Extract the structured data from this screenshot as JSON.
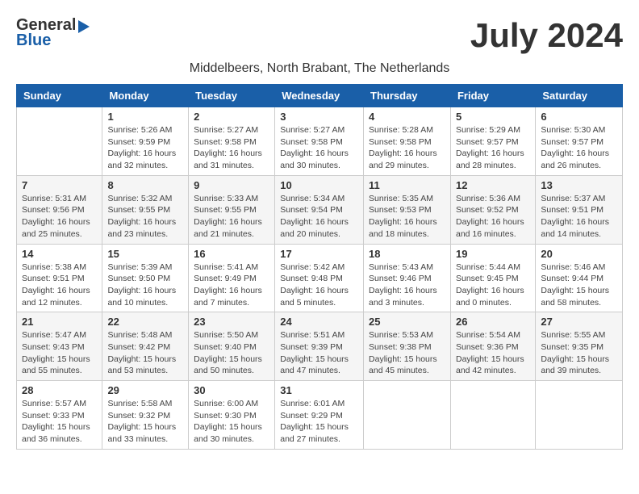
{
  "header": {
    "logo_general": "General",
    "logo_blue": "Blue",
    "month_title": "July 2024",
    "location": "Middelbeers, North Brabant, The Netherlands"
  },
  "weekdays": [
    "Sunday",
    "Monday",
    "Tuesday",
    "Wednesday",
    "Thursday",
    "Friday",
    "Saturday"
  ],
  "weeks": [
    [
      {
        "day": "",
        "info": ""
      },
      {
        "day": "1",
        "info": "Sunrise: 5:26 AM\nSunset: 9:59 PM\nDaylight: 16 hours\nand 32 minutes."
      },
      {
        "day": "2",
        "info": "Sunrise: 5:27 AM\nSunset: 9:58 PM\nDaylight: 16 hours\nand 31 minutes."
      },
      {
        "day": "3",
        "info": "Sunrise: 5:27 AM\nSunset: 9:58 PM\nDaylight: 16 hours\nand 30 minutes."
      },
      {
        "day": "4",
        "info": "Sunrise: 5:28 AM\nSunset: 9:58 PM\nDaylight: 16 hours\nand 29 minutes."
      },
      {
        "day": "5",
        "info": "Sunrise: 5:29 AM\nSunset: 9:57 PM\nDaylight: 16 hours\nand 28 minutes."
      },
      {
        "day": "6",
        "info": "Sunrise: 5:30 AM\nSunset: 9:57 PM\nDaylight: 16 hours\nand 26 minutes."
      }
    ],
    [
      {
        "day": "7",
        "info": "Sunrise: 5:31 AM\nSunset: 9:56 PM\nDaylight: 16 hours\nand 25 minutes."
      },
      {
        "day": "8",
        "info": "Sunrise: 5:32 AM\nSunset: 9:55 PM\nDaylight: 16 hours\nand 23 minutes."
      },
      {
        "day": "9",
        "info": "Sunrise: 5:33 AM\nSunset: 9:55 PM\nDaylight: 16 hours\nand 21 minutes."
      },
      {
        "day": "10",
        "info": "Sunrise: 5:34 AM\nSunset: 9:54 PM\nDaylight: 16 hours\nand 20 minutes."
      },
      {
        "day": "11",
        "info": "Sunrise: 5:35 AM\nSunset: 9:53 PM\nDaylight: 16 hours\nand 18 minutes."
      },
      {
        "day": "12",
        "info": "Sunrise: 5:36 AM\nSunset: 9:52 PM\nDaylight: 16 hours\nand 16 minutes."
      },
      {
        "day": "13",
        "info": "Sunrise: 5:37 AM\nSunset: 9:51 PM\nDaylight: 16 hours\nand 14 minutes."
      }
    ],
    [
      {
        "day": "14",
        "info": "Sunrise: 5:38 AM\nSunset: 9:51 PM\nDaylight: 16 hours\nand 12 minutes."
      },
      {
        "day": "15",
        "info": "Sunrise: 5:39 AM\nSunset: 9:50 PM\nDaylight: 16 hours\nand 10 minutes."
      },
      {
        "day": "16",
        "info": "Sunrise: 5:41 AM\nSunset: 9:49 PM\nDaylight: 16 hours\nand 7 minutes."
      },
      {
        "day": "17",
        "info": "Sunrise: 5:42 AM\nSunset: 9:48 PM\nDaylight: 16 hours\nand 5 minutes."
      },
      {
        "day": "18",
        "info": "Sunrise: 5:43 AM\nSunset: 9:46 PM\nDaylight: 16 hours\nand 3 minutes."
      },
      {
        "day": "19",
        "info": "Sunrise: 5:44 AM\nSunset: 9:45 PM\nDaylight: 16 hours\nand 0 minutes."
      },
      {
        "day": "20",
        "info": "Sunrise: 5:46 AM\nSunset: 9:44 PM\nDaylight: 15 hours\nand 58 minutes."
      }
    ],
    [
      {
        "day": "21",
        "info": "Sunrise: 5:47 AM\nSunset: 9:43 PM\nDaylight: 15 hours\nand 55 minutes."
      },
      {
        "day": "22",
        "info": "Sunrise: 5:48 AM\nSunset: 9:42 PM\nDaylight: 15 hours\nand 53 minutes."
      },
      {
        "day": "23",
        "info": "Sunrise: 5:50 AM\nSunset: 9:40 PM\nDaylight: 15 hours\nand 50 minutes."
      },
      {
        "day": "24",
        "info": "Sunrise: 5:51 AM\nSunset: 9:39 PM\nDaylight: 15 hours\nand 47 minutes."
      },
      {
        "day": "25",
        "info": "Sunrise: 5:53 AM\nSunset: 9:38 PM\nDaylight: 15 hours\nand 45 minutes."
      },
      {
        "day": "26",
        "info": "Sunrise: 5:54 AM\nSunset: 9:36 PM\nDaylight: 15 hours\nand 42 minutes."
      },
      {
        "day": "27",
        "info": "Sunrise: 5:55 AM\nSunset: 9:35 PM\nDaylight: 15 hours\nand 39 minutes."
      }
    ],
    [
      {
        "day": "28",
        "info": "Sunrise: 5:57 AM\nSunset: 9:33 PM\nDaylight: 15 hours\nand 36 minutes."
      },
      {
        "day": "29",
        "info": "Sunrise: 5:58 AM\nSunset: 9:32 PM\nDaylight: 15 hours\nand 33 minutes."
      },
      {
        "day": "30",
        "info": "Sunrise: 6:00 AM\nSunset: 9:30 PM\nDaylight: 15 hours\nand 30 minutes."
      },
      {
        "day": "31",
        "info": "Sunrise: 6:01 AM\nSunset: 9:29 PM\nDaylight: 15 hours\nand 27 minutes."
      },
      {
        "day": "",
        "info": ""
      },
      {
        "day": "",
        "info": ""
      },
      {
        "day": "",
        "info": ""
      }
    ]
  ]
}
